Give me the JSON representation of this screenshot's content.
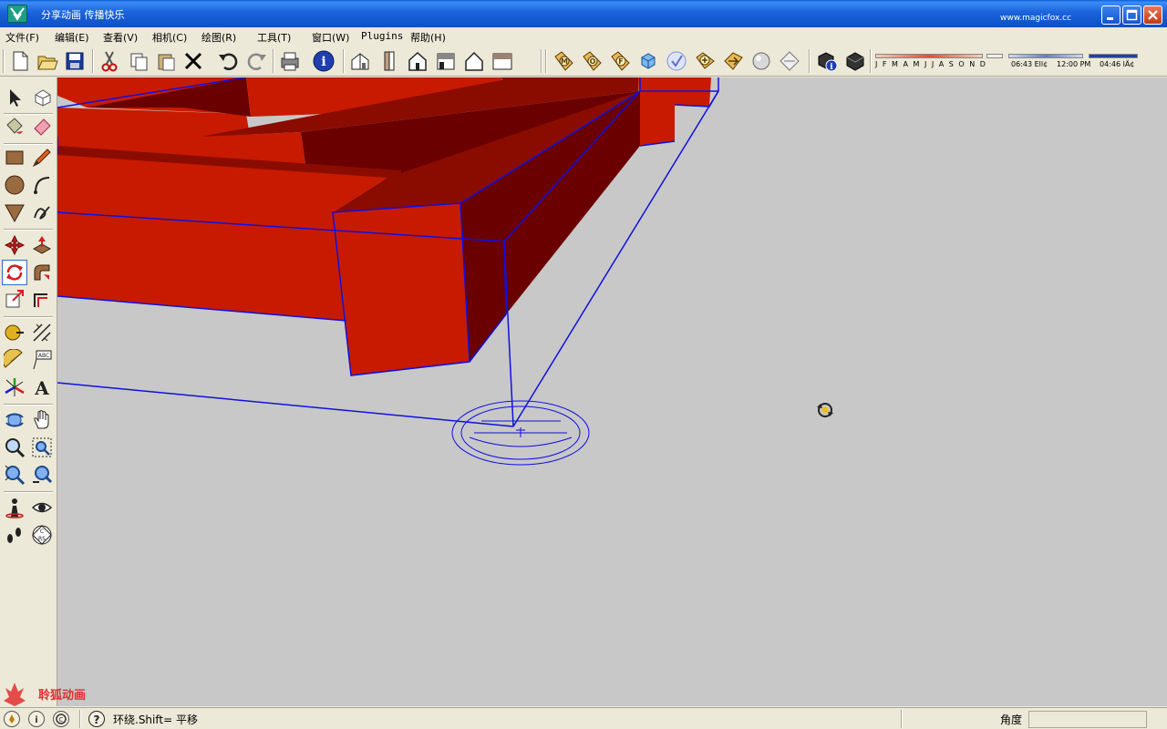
{
  "window": {
    "title": "分享动画  传播快乐",
    "url_text": "www.magicfox.cc"
  },
  "menu": [
    {
      "label": "文件(F)"
    },
    {
      "label": "编辑(E)"
    },
    {
      "label": "查看(V)"
    },
    {
      "label": "相机(C)"
    },
    {
      "label": "绘图(R)"
    },
    {
      "label": "工具(T)"
    },
    {
      "label": "窗口(W)"
    },
    {
      "label": "Plugins"
    },
    {
      "label": "帮助(H)"
    }
  ],
  "shadow": {
    "months": "J F M A M J J A S O N D",
    "time1": "06:43",
    "time1_suffix": "Ell¢",
    "time2": "12:00 PM",
    "time3": "04:46",
    "time3_suffix": "lÄ¢"
  },
  "status": {
    "hint": "环绕.Shift= 平移",
    "vcb_label": "角度",
    "vcb_value": ""
  },
  "watermark": {
    "text": "聆狐动画"
  },
  "colors": {
    "accent_title": "#0d4fc7",
    "model_red": "#c81a00",
    "model_dark": "#6b0000",
    "selection_blue": "#1010e0",
    "viewport_bg": "#c8c8c8"
  },
  "toolbar_icons": [
    "new-icon",
    "open-icon",
    "save-icon",
    "cut-icon",
    "copy-icon",
    "paste-icon",
    "erase-icon",
    "undo-icon",
    "redo-icon",
    "print-icon",
    "model-info-icon",
    "iso-view-icon",
    "top-view-icon",
    "front-view-icon",
    "right-view-icon",
    "back-view-icon",
    "left-view-icon",
    "tag-m-icon",
    "tag-o-icon",
    "tag-f-icon",
    "cube-icon",
    "check-icon",
    "tag-plus-icon",
    "tag-arrow-icon",
    "sphere-icon",
    "tag-diamond-icon",
    "component-info-icon",
    "box-icon"
  ],
  "palette_icons": [
    "select-icon",
    "make-component-icon",
    "paint-bucket-icon",
    "eraser-icon",
    "rectangle-icon",
    "pencil-icon",
    "circle-icon",
    "arc-icon",
    "polygon-icon",
    "freehand-icon",
    "move-icon",
    "push-pull-icon",
    "rotate-icon",
    "follow-me-icon",
    "scale-icon",
    "offset-icon",
    "tape-measure-icon",
    "dimension-icon",
    "protractor-icon",
    "text-icon",
    "axes-icon",
    "3d-text-icon",
    "orbit-icon",
    "pan-icon",
    "zoom-icon",
    "zoom-window-icon",
    "zoom-extents-icon",
    "previous-view-icon",
    "position-camera-icon",
    "look-around-icon",
    "walk-icon",
    "section-plane-icon"
  ]
}
